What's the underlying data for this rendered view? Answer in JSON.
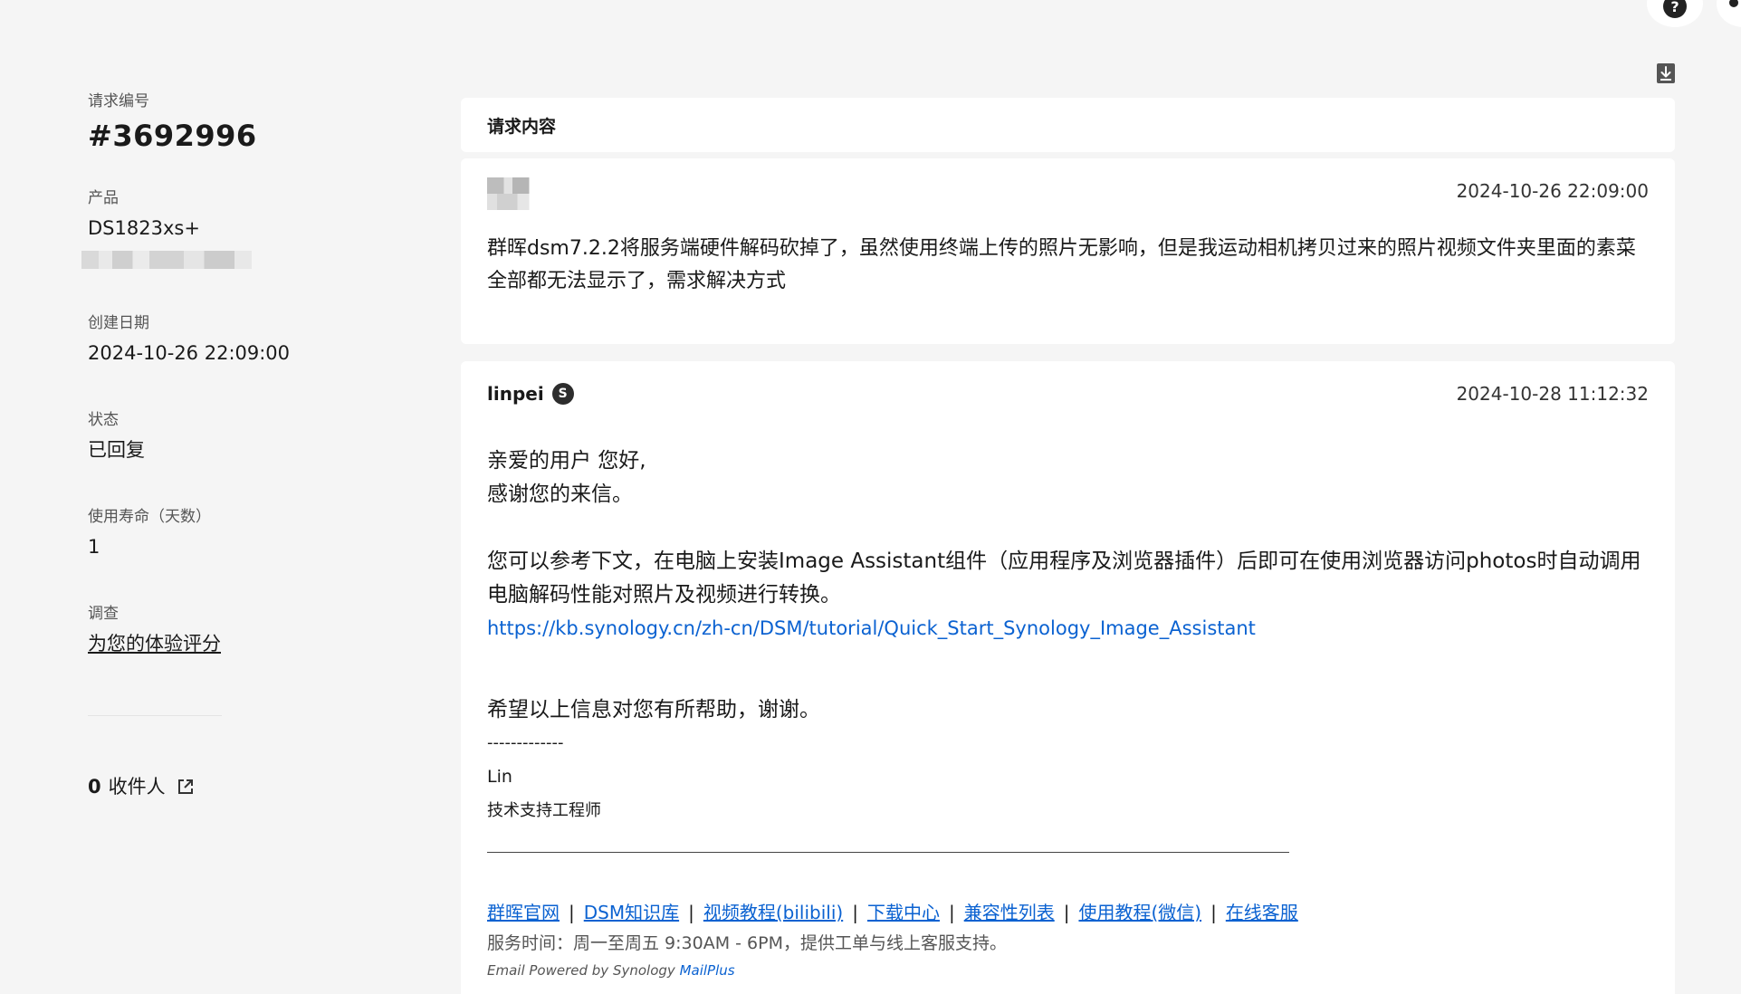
{
  "sidebar": {
    "ticket_label": "请求编号",
    "ticket_number": "#3692996",
    "product_label": "产品",
    "product_value": "DS1823xs+",
    "created_label": "创建日期",
    "created_value": "2024-10-26 22:09:00",
    "status_label": "状态",
    "status_value": "已回复",
    "lifetime_label": "使用寿命（天数）",
    "lifetime_value": "1",
    "survey_label": "调查",
    "survey_link": "为您的体验评分",
    "recipients_count": "0",
    "recipients_label": "收件人"
  },
  "header": {
    "title": "请求内容"
  },
  "request": {
    "timestamp": "2024-10-26 22:09:00",
    "body": "群晖dsm7.2.2将服务端硬件解码砍掉了，虽然使用终端上传的照片无影响，但是我运动相机拷贝过来的照片视频文件夹里面的素菜全部都无法显示了，需求解决方式"
  },
  "reply": {
    "author": "linpei",
    "author_badge": "S",
    "timestamp": "2024-10-28 11:12:32",
    "greeting": "亲爱的用户 您好,",
    "thanks": "感谢您的来信。",
    "paragraph": "您可以参考下文，在电脑上安装Image Assistant组件（应用程序及浏览器插件）后即可在使用浏览器访问photos时自动调用电脑解码性能对照片及视频进行转换。",
    "link": "https://kb.synology.cn/zh-cn/DSM/tutorial/Quick_Start_Synology_Image_Assistant",
    "closing": "希望以上信息对您有所帮助，谢谢。",
    "sig_dashes": "-------------",
    "sig_name": "Lin",
    "sig_title": "技术支持工程师",
    "footer_links": [
      "群晖官网",
      "DSM知识库",
      "视频教程(bilibili)",
      "下载中心",
      "兼容性列表",
      "使用教程(微信)",
      "在线客服"
    ],
    "footer_seps": [
      "|",
      "|",
      "|",
      "|",
      "|",
      "|"
    ],
    "service_hours": "服务时间：周一至周五 9:30AM - 6PM，提供工单与线上客服支持。",
    "email_powered_prefix": "Email Powered by Synology ",
    "email_powered_link": "MailPlus"
  },
  "icons": {
    "help": "help-icon",
    "user": "user-icon",
    "download": "download-icon",
    "external": "external-link-icon"
  }
}
